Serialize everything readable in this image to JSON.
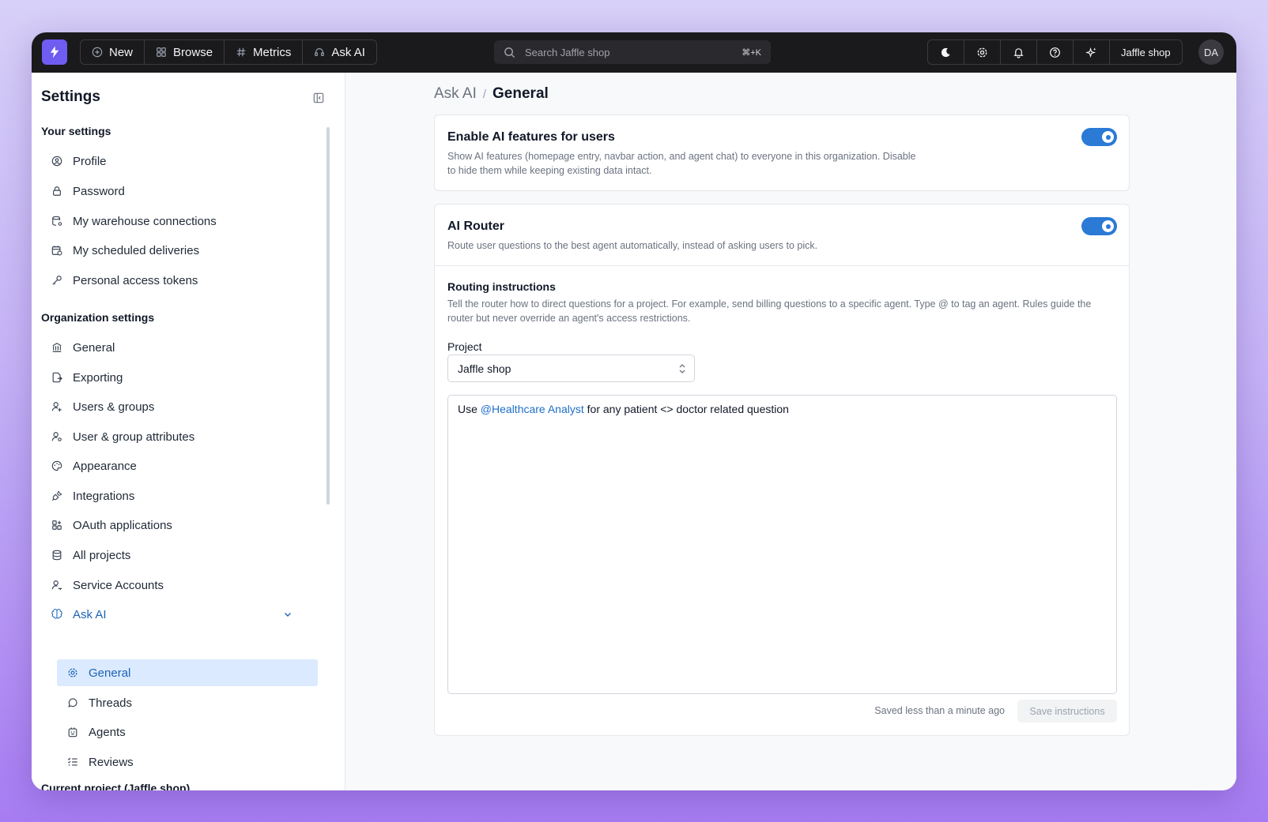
{
  "navbar": {
    "new_label": "New",
    "browse_label": "Browse",
    "metrics_label": "Metrics",
    "ask_ai_label": "Ask AI",
    "search_placeholder": "Search Jaffle shop",
    "search_shortcut": "⌘+K",
    "project_label": "Jaffle shop",
    "avatar_initials": "DA"
  },
  "sidebar": {
    "title": "Settings",
    "your_settings_heading": "Your settings",
    "your_settings": [
      {
        "label": "Profile",
        "icon": "user-circle-icon"
      },
      {
        "label": "Password",
        "icon": "lock-icon"
      },
      {
        "label": "My warehouse connections",
        "icon": "database-cog-icon"
      },
      {
        "label": "My scheduled deliveries",
        "icon": "calendar-clock-icon"
      },
      {
        "label": "Personal access tokens",
        "icon": "key-icon"
      }
    ],
    "org_settings_heading": "Organization settings",
    "org_settings": [
      {
        "label": "General",
        "icon": "building-bank-icon"
      },
      {
        "label": "Exporting",
        "icon": "file-export-icon"
      },
      {
        "label": "Users & groups",
        "icon": "user-plus-icon"
      },
      {
        "label": "User & group attributes",
        "icon": "user-cog-icon"
      },
      {
        "label": "Appearance",
        "icon": "palette-icon"
      },
      {
        "label": "Integrations",
        "icon": "plug-icon"
      },
      {
        "label": "OAuth applications",
        "icon": "apps-icon"
      },
      {
        "label": "All projects",
        "icon": "database-icon"
      },
      {
        "label": "Service Accounts",
        "icon": "user-key-icon"
      }
    ],
    "ask_ai_label": "Ask AI",
    "ask_ai_children": [
      {
        "label": "General",
        "icon": "gear-icon"
      },
      {
        "label": "Threads",
        "icon": "message-circle-icon"
      },
      {
        "label": "Agents",
        "icon": "robot-icon"
      },
      {
        "label": "Reviews",
        "icon": "list-check-icon"
      }
    ],
    "current_project_heading": "Current project (Jaffle shop)"
  },
  "main": {
    "breadcrumb_parent": "Ask AI",
    "breadcrumb_separator": "/",
    "breadcrumb_current": "General",
    "enable_card": {
      "title": "Enable AI features for users",
      "description": "Show AI features (homepage entry, navbar action, and agent chat) to everyone in this organization. Disable to hide them while keeping existing data intact.",
      "enabled": true
    },
    "router_card": {
      "title": "AI Router",
      "description": "Route user questions to the best agent automatically, instead of asking users to pick.",
      "enabled": true,
      "routing_heading": "Routing instructions",
      "routing_description": "Tell the router how to direct questions for a project. For example, send billing questions to a specific agent. Type @ to tag an agent. Rules guide the router but never override an agent's access restrictions.",
      "project_label": "Project",
      "project_value": "Jaffle shop",
      "instruction_prefix": "Use ",
      "instruction_mention": "@Healthcare Analyst",
      "instruction_suffix": " for any patient <> doctor related question",
      "saved_status": "Saved less than a minute ago",
      "save_button": "Save instructions"
    }
  },
  "colors": {
    "accent": "#2a7ad6",
    "navbar_bg": "#1a1a1d",
    "logo_bg": "#6f5cf1",
    "active_bg": "#dbeafe"
  }
}
